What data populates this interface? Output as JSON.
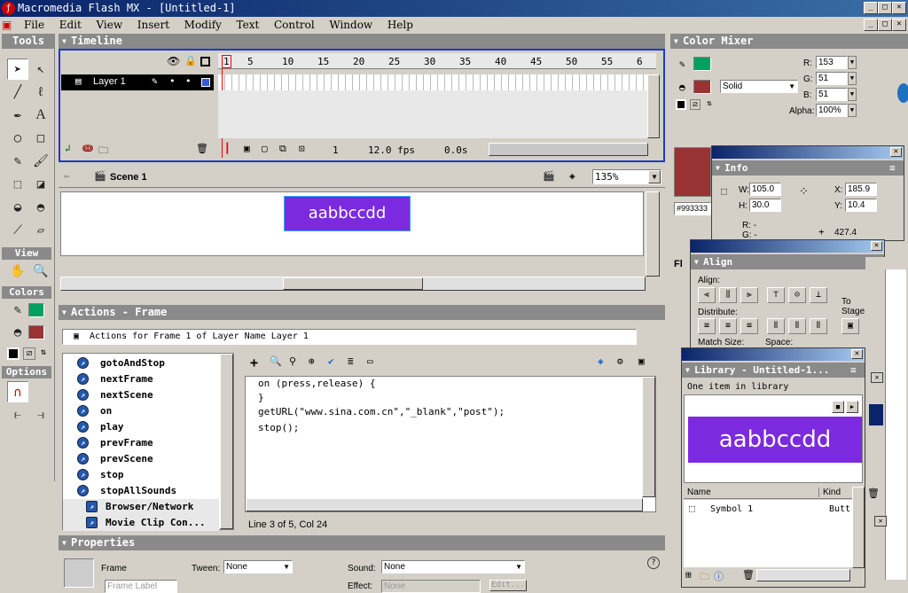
{
  "window": {
    "title": "Macromedia Flash MX - [Untitled-1]",
    "min": "_",
    "max": "□",
    "close": "✕"
  },
  "menu": [
    "File",
    "Edit",
    "View",
    "Insert",
    "Modify",
    "Text",
    "Control",
    "Window",
    "Help"
  ],
  "tools": {
    "title": "Tools",
    "view": "View",
    "colors": "Colors",
    "options": "Options"
  },
  "timeline": {
    "title": "Timeline",
    "layer": "Layer 1",
    "frames": [
      "1",
      "5",
      "10",
      "15",
      "20",
      "25",
      "30",
      "35",
      "40",
      "45",
      "50",
      "55",
      "6"
    ],
    "current_frame": "1",
    "fps": "12.0 fps",
    "time": "0.0s"
  },
  "stage": {
    "scene": "Scene 1",
    "zoom": "135%",
    "button_text": "aabbccdd"
  },
  "actions": {
    "title": "Actions - Frame",
    "target": "Actions for Frame 1 of Layer Name Layer 1",
    "items": [
      "gotoAndStop",
      "nextFrame",
      "nextScene",
      "on",
      "play",
      "prevFrame",
      "prevScene",
      "stop",
      "stopAllSounds"
    ],
    "folders": [
      "Browser/Network",
      "Movie Clip Con..."
    ],
    "code": [
      "on (press,release) {",
      "}",
      "getURL(\"www.sina.com.cn\",\"_blank\",\"post\");",
      "stop();"
    ],
    "status": "Line 3 of 5, Col 24"
  },
  "properties": {
    "title": "Properties",
    "frame_label": "Frame",
    "frame_placeholder": "Frame Label",
    "tween_label": "Tween:",
    "tween_value": "None",
    "sound_label": "Sound:",
    "sound_value": "None",
    "effect_label": "Effect:",
    "effect_value": "None",
    "edit": "Edit..."
  },
  "color_mixer": {
    "title": "Color Mixer",
    "r_label": "R:",
    "r": "153",
    "g_label": "G:",
    "g": "51",
    "b_label": "B:",
    "b": "51",
    "alpha_label": "Alpha:",
    "alpha": "100%",
    "type": "Solid",
    "hex": "#993333",
    "swatch": "#993333"
  },
  "info": {
    "title": "Info",
    "w_label": "W:",
    "w": "105.0",
    "h_label": "H:",
    "h": "30.0",
    "x_label": "X:",
    "x": "185.9",
    "y_label": "Y:",
    "y": "10.4",
    "r_label": "R: -",
    "g_label": "G: -",
    "coord": "427.4"
  },
  "align": {
    "title": "Align",
    "align_label": "Align:",
    "distribute_label": "Distribute:",
    "match_label": "Match Size:",
    "space_label": "Space:",
    "to_label": "To",
    "stage_label": "Stage:"
  },
  "library": {
    "title": "Library - Untitled-1...",
    "count": "One item in library",
    "preview_text": "aabbccdd",
    "col_name": "Name",
    "col_kind": "Kind",
    "symbol": "Symbol 1",
    "kind": "Butt"
  },
  "fl_label": "Fl"
}
